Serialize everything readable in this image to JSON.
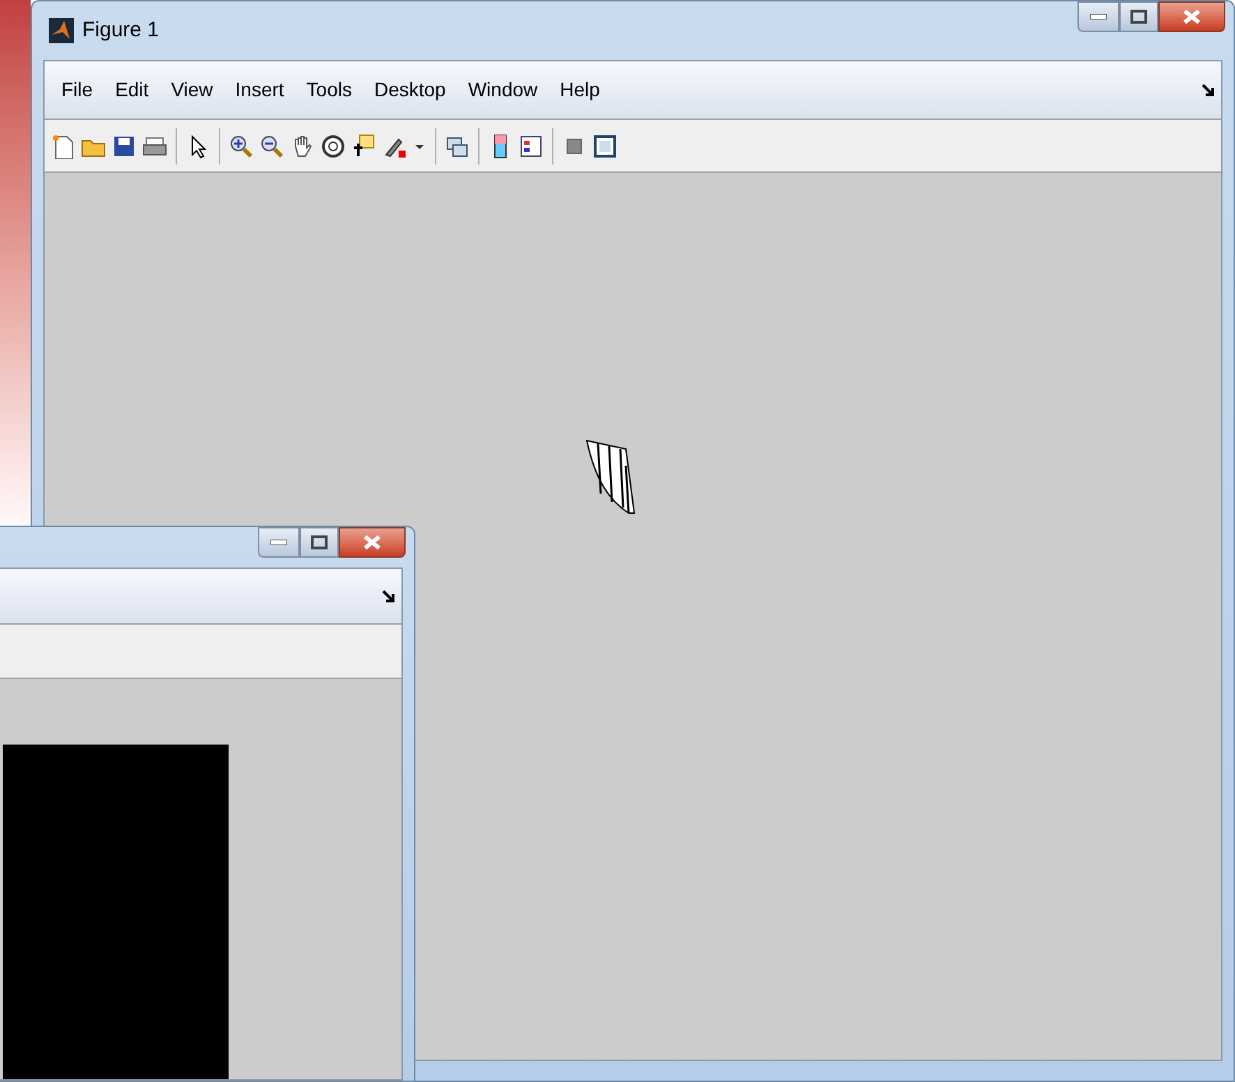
{
  "main_window": {
    "title": "Figure 1",
    "menu": [
      {
        "label": "File"
      },
      {
        "label": "Edit"
      },
      {
        "label": "View"
      },
      {
        "label": "Insert"
      },
      {
        "label": "Tools"
      },
      {
        "label": "Desktop"
      },
      {
        "label": "Window"
      },
      {
        "label": "Help"
      }
    ]
  }
}
